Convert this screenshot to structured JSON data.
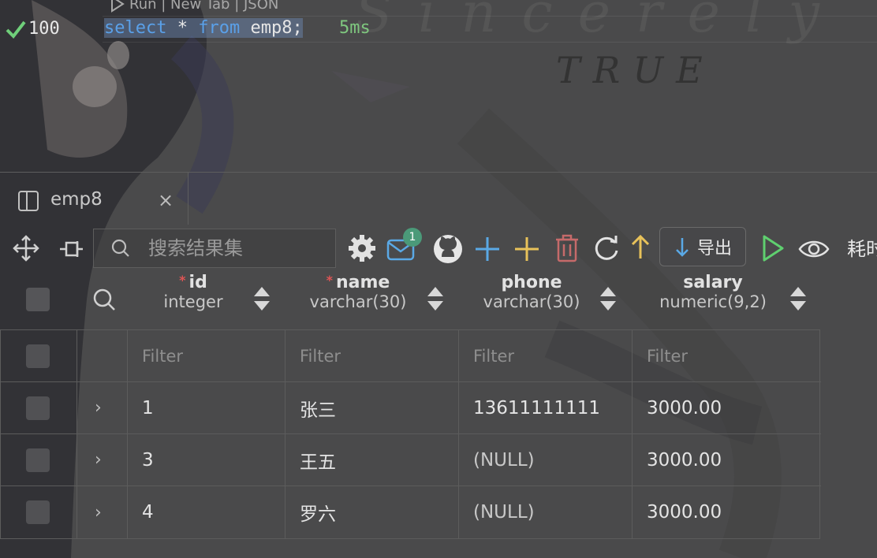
{
  "editor": {
    "codelens": "Run | New Tab | JSON",
    "line_number": "100",
    "sql_keyword_select": "select",
    "sql_star": "*",
    "sql_keyword_from": "from",
    "sql_table": "emp8;",
    "timing": "5ms",
    "status_icon": "check-icon",
    "background_text_line1": "Sincerely",
    "background_text_line2": "TRUE"
  },
  "tab": {
    "label": "emp8",
    "close": "×"
  },
  "toolbar": {
    "search_placeholder": "搜索结果集",
    "mail_badge": "1",
    "export_label": "导出",
    "more_label": "耗时",
    "icons": [
      "move-icon",
      "pin-icon",
      "search-icon",
      "gear-icon",
      "mail-icon",
      "github-icon",
      "add-row-icon",
      "add-column-icon",
      "delete-icon",
      "refresh-icon",
      "up-arrow-icon",
      "download-icon",
      "run-icon",
      "eye-icon"
    ]
  },
  "columns": [
    {
      "name": "id",
      "type": "integer",
      "required": true
    },
    {
      "name": "name",
      "type": "varchar(30)",
      "required": true
    },
    {
      "name": "phone",
      "type": "varchar(30)",
      "required": false
    },
    {
      "name": "salary",
      "type": "numeric(9,2)",
      "required": false
    }
  ],
  "filter_placeholder": "Filter",
  "rows": [
    {
      "id": "1",
      "name": "张三",
      "phone": "13611111111",
      "salary": "3000.00"
    },
    {
      "id": "3",
      "name": "王五",
      "phone": "(NULL)",
      "salary": "3000.00"
    },
    {
      "id": "4",
      "name": "罗六",
      "phone": "(NULL)",
      "salary": "3000.00"
    }
  ],
  "colors": {
    "background": "#4a4a4b",
    "keyword": "#5aa0e8",
    "timing": "#7fc77f",
    "check": "#6fcf7a",
    "badge": "#4b9a79",
    "add_blue": "#5aa9e6",
    "add_yellow": "#e8c25a",
    "delete_red": "#c66a6a",
    "run_green": "#5fcf6f"
  }
}
